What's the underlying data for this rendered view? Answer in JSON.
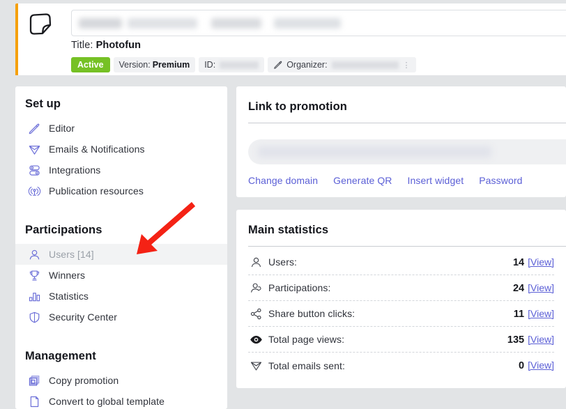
{
  "header": {
    "logo_icon": "sticker-folded-corner-icon",
    "title_input_value": "",
    "title_input_redacted": true,
    "title_label": "Title:",
    "title_value": "Photofun",
    "badges": {
      "status": "Active",
      "version_label": "Version:",
      "version_value": "Premium",
      "id_label": "ID:",
      "id_value": "",
      "organizer_label": "Organizer:",
      "organizer_value": "",
      "organizer_icon": "pencil-icon",
      "overflow_dots": "⋮"
    }
  },
  "sidebar": {
    "sections": [
      {
        "title": "Set up",
        "items": [
          {
            "label": "Editor",
            "icon": "pencil-icon",
            "selected": false
          },
          {
            "label": "Emails & Notifications",
            "icon": "paper-plane-icon",
            "selected": false
          },
          {
            "label": "Integrations",
            "icon": "toggles-icon",
            "selected": false
          },
          {
            "label": "Publication resources",
            "icon": "broadcast-antenna-icon",
            "selected": false
          }
        ]
      },
      {
        "title": "Participations",
        "items": [
          {
            "label": "Users [14]",
            "icon": "user-icon",
            "selected": true
          },
          {
            "label": "Winners",
            "icon": "trophy-icon",
            "selected": false
          },
          {
            "label": "Statistics",
            "icon": "bar-chart-icon",
            "selected": false
          },
          {
            "label": "Security Center",
            "icon": "shield-icon",
            "selected": false
          }
        ]
      },
      {
        "title": "Management",
        "items": [
          {
            "label": "Copy promotion",
            "icon": "copy-icon",
            "selected": false
          },
          {
            "label": "Convert to global template",
            "icon": "document-page-icon",
            "selected": false
          }
        ]
      }
    ]
  },
  "link_card": {
    "title": "Link to promotion",
    "url_value": "",
    "url_redacted": true,
    "actions": [
      {
        "label": "Change domain"
      },
      {
        "label": "Generate QR"
      },
      {
        "label": "Insert widget"
      },
      {
        "label": "Password"
      }
    ]
  },
  "stats_card": {
    "title": "Main statistics",
    "view_label": "[View]",
    "rows": [
      {
        "label": "Users:",
        "value": "14",
        "icon": "user-icon"
      },
      {
        "label": "Participations:",
        "value": "24",
        "icon": "user-hand-icon"
      },
      {
        "label": "Share button clicks:",
        "value": "11",
        "icon": "share-nodes-icon"
      },
      {
        "label": "Total page views:",
        "value": "135",
        "icon": "eye-icon"
      },
      {
        "label": "Total emails sent:",
        "value": "0",
        "icon": "paper-plane-icon"
      }
    ]
  },
  "annotation": {
    "arrow": {
      "color": "#f42215",
      "points_to": "sidebar-item-users"
    }
  },
  "colors": {
    "accent_orange": "#f5a00d",
    "status_green": "#76c125",
    "link_purple": "#5b5fd6",
    "icon_purple": "#6c6fd8",
    "page_background": "#e2e4e6",
    "card_background": "#ffffff"
  }
}
